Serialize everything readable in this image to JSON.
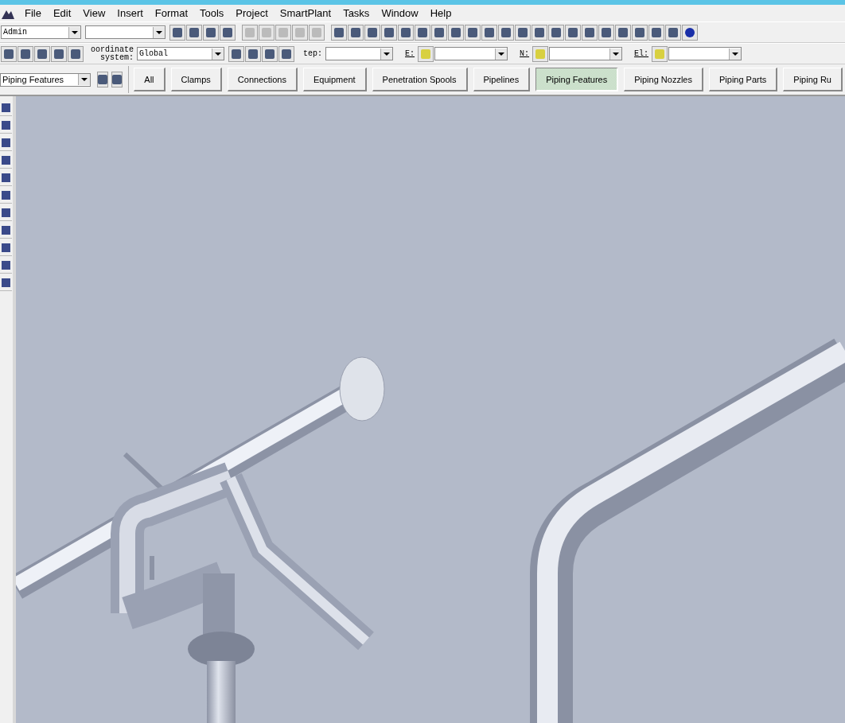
{
  "menu": [
    "File",
    "Edit",
    "View",
    "Insert",
    "Format",
    "Tools",
    "Project",
    "SmartPlant",
    "Tasks",
    "Window",
    "Help"
  ],
  "toolbar": {
    "user": "Admin"
  },
  "locate_bar": {
    "coordinate_label_1": "oordinate",
    "coordinate_label_2": "system:",
    "coordinate_system": "Global",
    "step_label": "tep:",
    "e_label": "E:",
    "n_label": "N:",
    "el_label": "El:"
  },
  "filter": {
    "value": "Piping Features"
  },
  "tabs": [
    {
      "label": "All",
      "selected": false
    },
    {
      "label": "Clamps",
      "selected": false
    },
    {
      "label": "Connections",
      "selected": false
    },
    {
      "label": "Equipment",
      "selected": false
    },
    {
      "label": "Penetration Spools",
      "selected": false
    },
    {
      "label": "Pipelines",
      "selected": false
    },
    {
      "label": "Piping Features",
      "selected": true
    },
    {
      "label": "Piping Nozzles",
      "selected": false
    },
    {
      "label": "Piping Parts",
      "selected": false
    },
    {
      "label": "Piping Ru",
      "selected": false
    }
  ]
}
